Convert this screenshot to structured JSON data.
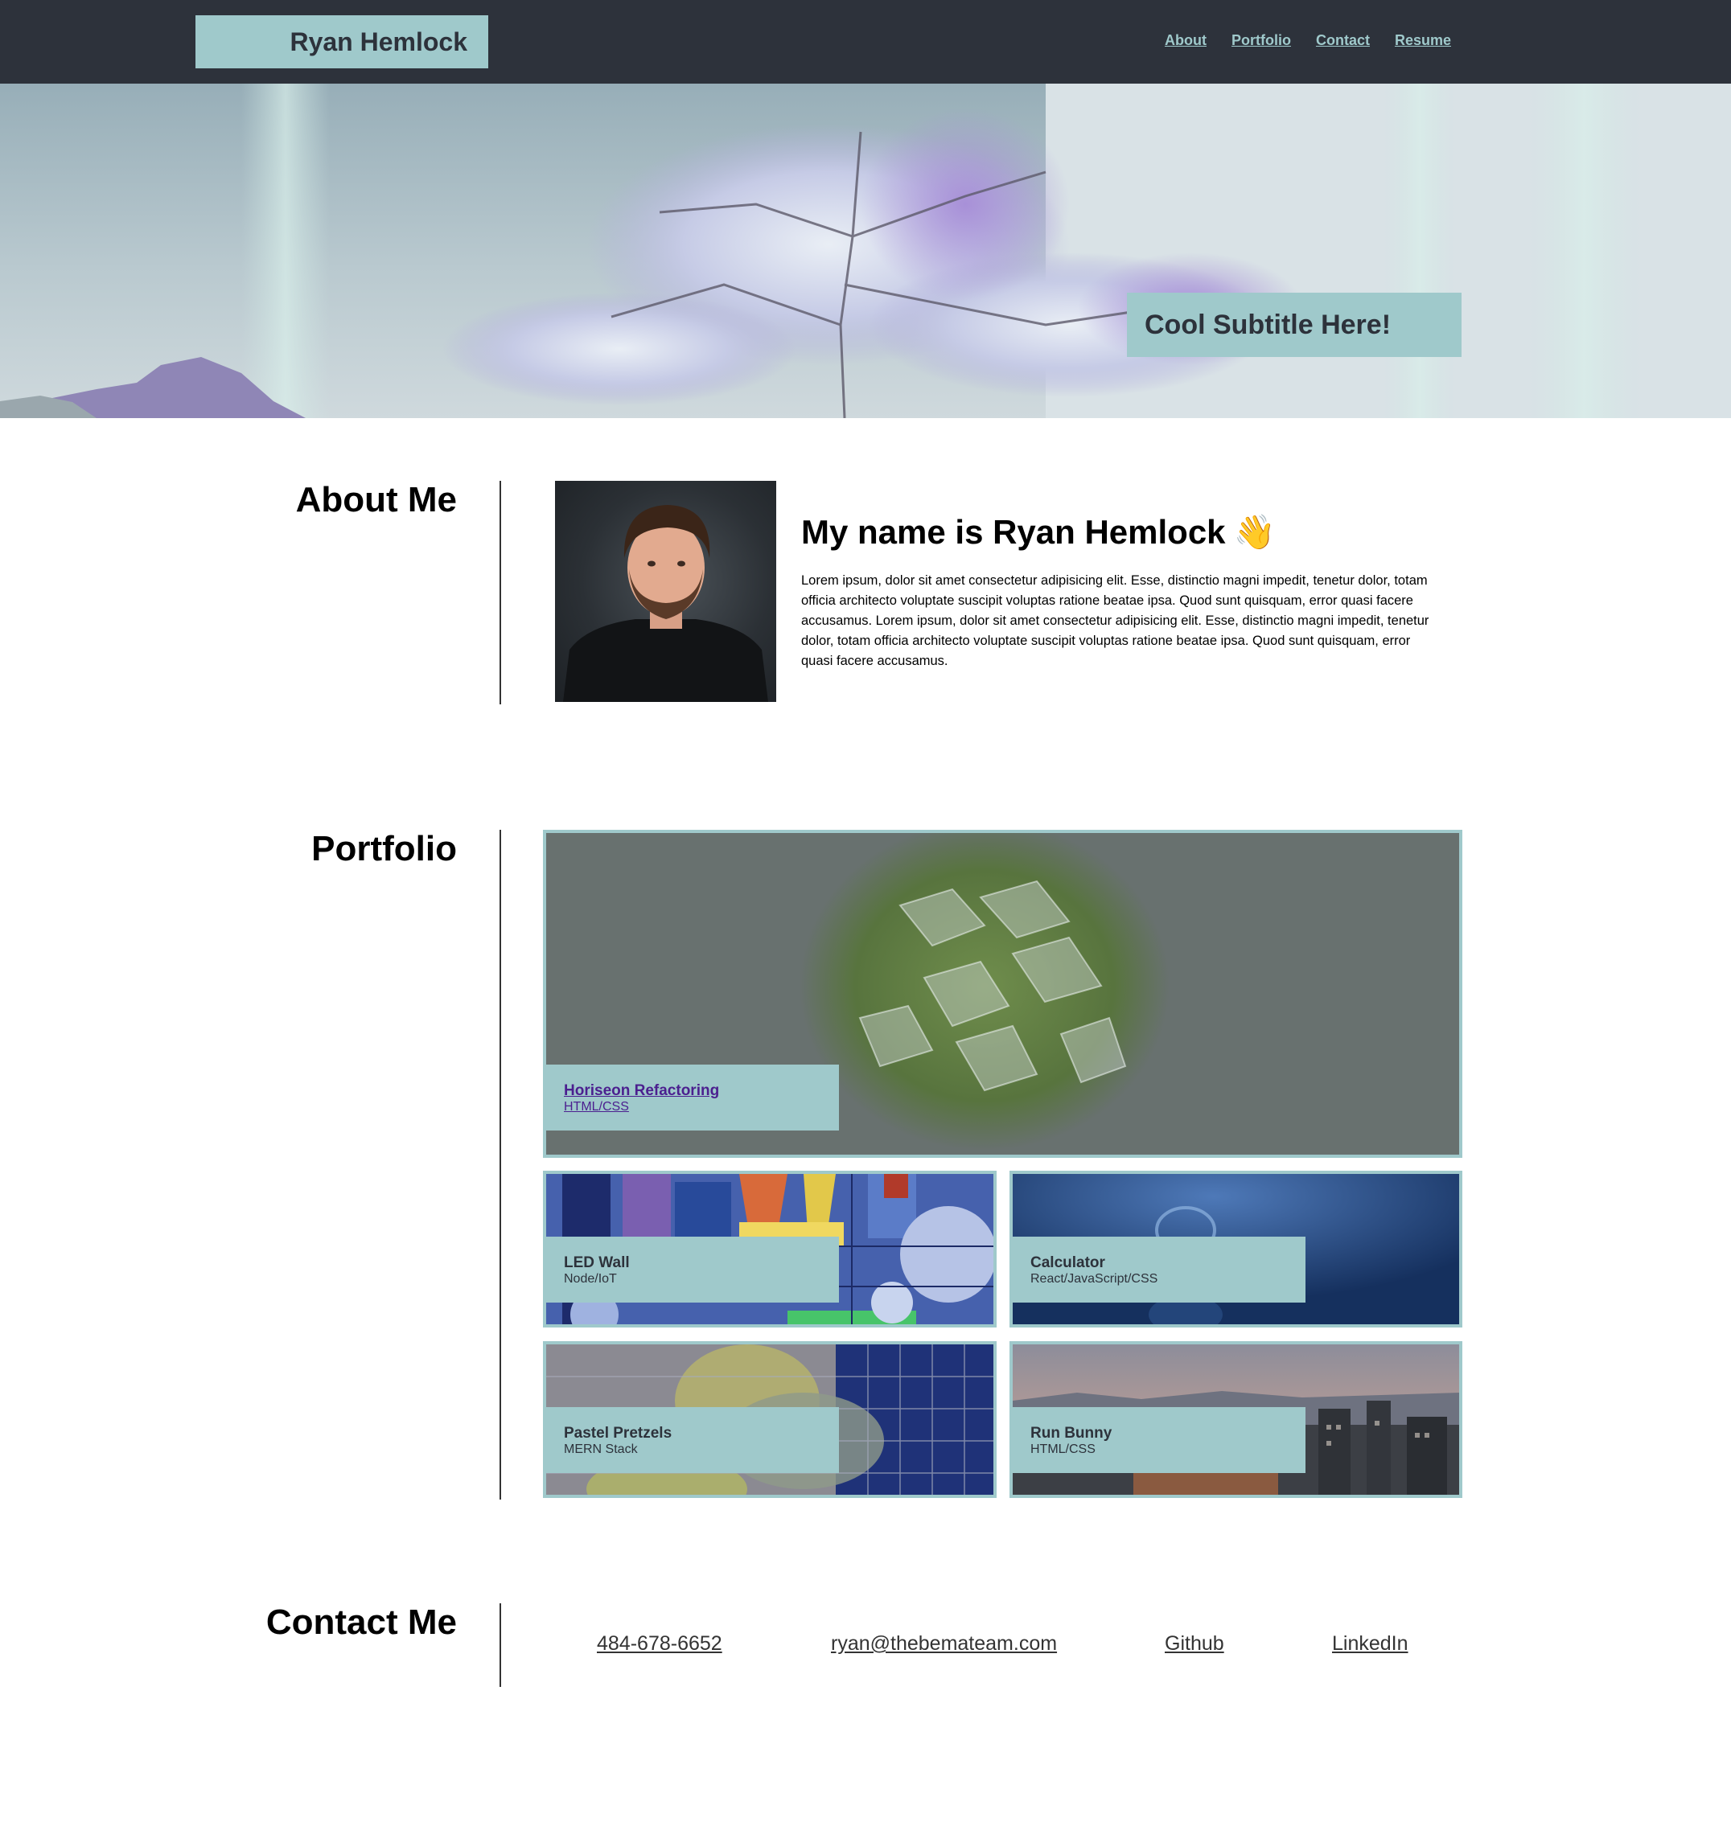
{
  "header": {
    "brand": "Ryan Hemlock",
    "nav": [
      "About",
      "Portfolio",
      "Contact",
      "Resume"
    ]
  },
  "hero": {
    "subtitle": "Cool Subtitle Here!"
  },
  "about": {
    "section_title": "About Me",
    "heading": "My name is Ryan Hemlock",
    "wave": "👋",
    "body": "Lorem ipsum, dolor sit amet consectetur adipisicing elit. Esse, distinctio magni impedit, tenetur dolor, totam officia architecto voluptate suscipit voluptas ratione beatae ipsa. Quod sunt quisquam, error quasi facere accusamus. Lorem ipsum, dolor sit amet consectetur adipisicing elit. Esse, distinctio magni impedit, tenetur dolor, totam officia architecto voluptate suscipit voluptas ratione beatae ipsa. Quod sunt quisquam, error quasi facere accusamus."
  },
  "portfolio": {
    "section_title": "Portfolio",
    "projects": [
      {
        "title": "Horiseon Refactoring",
        "tech": "HTML/CSS"
      },
      {
        "title": "LED Wall",
        "tech": "Node/IoT"
      },
      {
        "title": "Calculator",
        "tech": "React/JavaScript/CSS"
      },
      {
        "title": "Pastel Pretzels",
        "tech": "MERN Stack"
      },
      {
        "title": "Run Bunny",
        "tech": "HTML/CSS"
      }
    ]
  },
  "contact": {
    "section_title": "Contact Me",
    "phone": "484-678-6652",
    "email": "ryan@thebemateam.com",
    "github": "Github",
    "linkedin": "LinkedIn"
  },
  "colors": {
    "header_bg": "#2d323b",
    "accent": "#9fc9cb",
    "visited_link": "#4b1f8f"
  }
}
